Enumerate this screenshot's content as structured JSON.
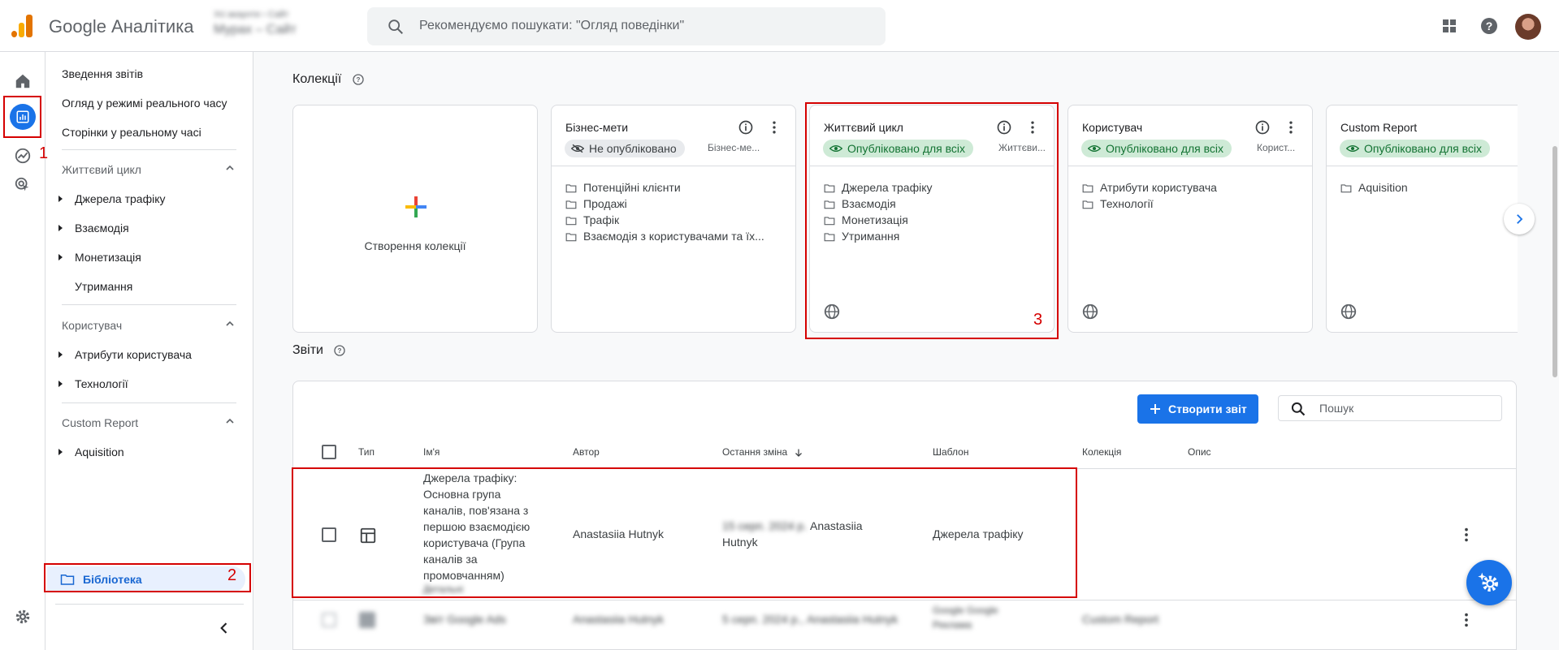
{
  "header": {
    "product_name": "Google Аналітика",
    "account_line1": "Усі акаунти › Сайт",
    "account_line2": "Мурах – Сайт",
    "search_placeholder": "Рекомендуємо пошукати: \"Огляд поведінки\""
  },
  "nav": {
    "items": [
      "Зведення звітів",
      "Огляд у режимі реального часу",
      "Сторінки у реальному часі"
    ],
    "sections": [
      {
        "title": "Життєвий цикл",
        "subitems": [
          "Джерела трафіку",
          "Взаємодія",
          "Монетизація",
          "Утримання"
        ]
      },
      {
        "title": "Користувач",
        "subitems": [
          "Атрибути користувача",
          "Технології"
        ]
      },
      {
        "title": "Custom Report",
        "subitems": [
          "Aquisition"
        ]
      }
    ],
    "library_label": "Бібліотека"
  },
  "collections": {
    "title": "Колекції",
    "create_label": "Створення колекції",
    "cards": [
      {
        "title": "Бізнес-мети",
        "status": "Не опубліковано",
        "sub": "Бізнес-ме...",
        "folders": [
          "Потенційні клієнти",
          "Продажі",
          "Трафік",
          "Взаємодія з користувачами та їх..."
        ]
      },
      {
        "title": "Життєвий цикл",
        "status": "Опубліковано для всіх",
        "sub": "Життєви...",
        "folders": [
          "Джерела трафіку",
          "Взаємодія",
          "Монетизація",
          "Утримання"
        ]
      },
      {
        "title": "Користувач",
        "status": "Опубліковано для всіх",
        "sub": "Корист...",
        "folders": [
          "Атрибути користувача",
          "Технології"
        ]
      },
      {
        "title": "Custom Report",
        "status": "Опубліковано для всіх",
        "sub": "",
        "folders": [
          "Aquisition"
        ]
      }
    ]
  },
  "reports": {
    "title": "Звіти",
    "create_button": "Створити звіт",
    "search_placeholder": "Пошук",
    "columns": [
      "Тип",
      "Ім'я",
      "Автор",
      "Остання зміна",
      "Шаблон",
      "Колекція",
      "Опис"
    ],
    "rows": [
      {
        "name": "Джерела трафіку: Основна група каналів, пов'язана з першою взаємодією користувача (Група каналів за промовчанням)",
        "name_blur": "Детальні",
        "author": "Anastasiia Hutnyk",
        "modified_blur": "15 серп. 2024 р.",
        "modified_author": "Anastasiia Hutnyk",
        "template": "Джерела трафіку",
        "collection": "",
        "description": ""
      },
      {
        "name": "Звіт Google Ads",
        "author": "Anastasiia Hutnyk",
        "modified": "5 серп. 2024 р., Anastasiia Hutnyk",
        "template": "Google Google Реклама",
        "collection": "Custom Report"
      }
    ]
  },
  "annotations": [
    "1",
    "2",
    "3"
  ],
  "colors": {
    "accent": "#1a73e8",
    "annotation": "#d50000",
    "published": "#137333"
  }
}
